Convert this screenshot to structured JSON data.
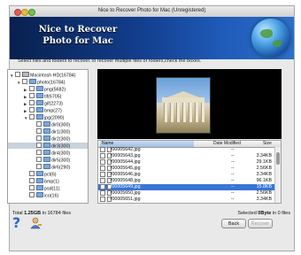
{
  "window": {
    "title": "Nice to Recover Photo for Mac (Unregistered)"
  },
  "banner": {
    "line1": "Nice to Recover",
    "line2": "Photo for Mac"
  },
  "instruction": "Select files and folders to recover.To recover multiple files or folders,check the boxes.",
  "tree": {
    "items": [
      {
        "label": "Macintosh HD(16784)",
        "depth": 0,
        "expanded": true,
        "icon": "drive-icon"
      },
      {
        "label": "photo(16784)",
        "depth": 1,
        "expanded": true,
        "icon": "folder-icon"
      },
      {
        "label": "png(5682)",
        "depth": 2,
        "expanded": false,
        "icon": "folder-icon"
      },
      {
        "label": "tif(6705)",
        "depth": 2,
        "expanded": false,
        "icon": "folder-icon"
      },
      {
        "label": "gif(2273)",
        "depth": 2,
        "expanded": false,
        "icon": "folder-icon"
      },
      {
        "label": "bmp(27)",
        "depth": 2,
        "expanded": false,
        "icon": "folder-icon"
      },
      {
        "label": "jpg(2090)",
        "depth": 2,
        "expanded": true,
        "icon": "folder-icon"
      },
      {
        "label": "dir0(300)",
        "depth": 3,
        "icon": "folder-icon"
      },
      {
        "label": "dir1(300)",
        "depth": 3,
        "icon": "folder-icon"
      },
      {
        "label": "dir2(300)",
        "depth": 3,
        "icon": "folder-icon"
      },
      {
        "label": "dir3(300)",
        "depth": 3,
        "icon": "folder-icon",
        "selected": true
      },
      {
        "label": "dir4(300)",
        "depth": 3,
        "icon": "folder-icon"
      },
      {
        "label": "dir5(300)",
        "depth": 3,
        "icon": "folder-icon"
      },
      {
        "label": "dir6(290)",
        "depth": 3,
        "icon": "folder-icon"
      },
      {
        "label": "pct(6)",
        "depth": 2,
        "icon": "folder-icon"
      },
      {
        "label": "bmp(1)",
        "depth": 2,
        "icon": "folder-icon"
      },
      {
        "label": "psd(11)",
        "depth": 2,
        "icon": "folder-icon"
      },
      {
        "label": "ico(16)",
        "depth": 2,
        "icon": "folder-icon"
      }
    ]
  },
  "filelist": {
    "columns": {
      "name": "Name",
      "date": "Date Modified",
      "size": "Size"
    },
    "rows": [
      {
        "name": "f00005642.jpg",
        "date": "--",
        "size": "",
        "selected": false
      },
      {
        "name": "f00005643.jpg",
        "date": "--",
        "size": "3.34KB",
        "selected": false
      },
      {
        "name": "f00005644.jpg",
        "date": "--",
        "size": "29.1KB",
        "selected": false
      },
      {
        "name": "f00005645.jpg",
        "date": "--",
        "size": "2.56KB",
        "selected": false
      },
      {
        "name": "f00005646.jpg",
        "date": "--",
        "size": "3.34KB",
        "selected": false
      },
      {
        "name": "f00005648.jpg",
        "date": "--",
        "size": "96.1KB",
        "selected": false
      },
      {
        "name": "f00005649.jpg",
        "date": "--",
        "size": "15.8KB",
        "selected": true
      },
      {
        "name": "f00005650.jpg",
        "date": "--",
        "size": "2.56KB",
        "selected": false
      },
      {
        "name": "f00005651.jpg",
        "date": "--",
        "size": "3.34KB",
        "selected": false
      },
      {
        "name": "f00005652.jpg",
        "date": "--",
        "size": "",
        "selected": false
      }
    ]
  },
  "status": {
    "total_prefix": "Total",
    "total_size": "1.25GB",
    "total_suffix": "in 16784 files",
    "selected_prefix": "Selected",
    "selected_size": "0Byte",
    "selected_suffix": "in 0 files"
  },
  "buttons": {
    "back": "Back",
    "recover": "Recover"
  },
  "colors": {
    "selection": "#3875d7",
    "banner": "#123d8c",
    "tree_selection": "#c9d3de"
  }
}
